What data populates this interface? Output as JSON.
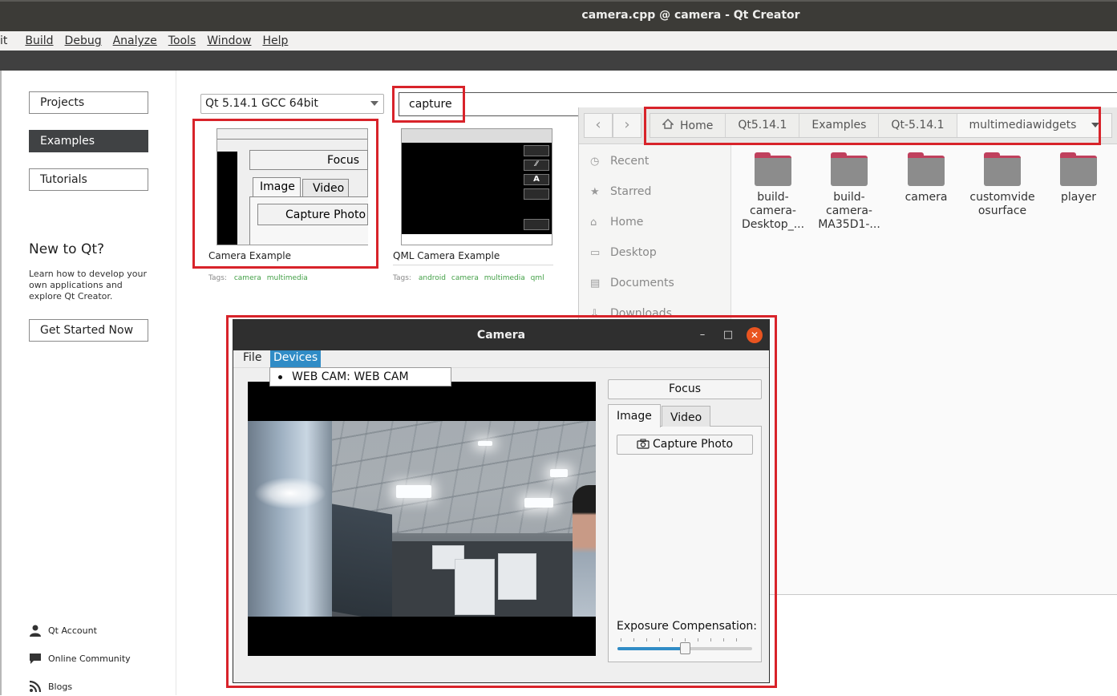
{
  "window": {
    "title": "camera.cpp @ camera - Qt Creator"
  },
  "menubar": {
    "items": [
      "it",
      "Build",
      "Debug",
      "Analyze",
      "Tools",
      "Window",
      "Help"
    ]
  },
  "welcome": {
    "nav": [
      "Projects",
      "Examples",
      "Tutorials"
    ],
    "active_nav": "Examples",
    "new_title": "New to Qt?",
    "new_desc": "Learn how to develop your own applications and explore Qt Creator.",
    "get_started": "Get Started Now",
    "footer": [
      {
        "label": "Qt Account",
        "icon": "user-icon"
      },
      {
        "label": "Online Community",
        "icon": "chat-icon"
      },
      {
        "label": "Blogs",
        "icon": "rss-icon"
      }
    ]
  },
  "examples": {
    "qt_version": "Qt 5.14.1 GCC 64bit",
    "search_value": "capture",
    "tags_label": "Tags:",
    "items": [
      {
        "name": "Camera Example",
        "tags": [
          "camera",
          "multimedia"
        ],
        "thumb": {
          "focus": "Focus",
          "tab_image": "Image",
          "tab_video": "Video",
          "capture": "Capture Photo"
        }
      },
      {
        "name": "QML Camera Example",
        "tags": [
          "android",
          "camera",
          "multimedia",
          "qml"
        ]
      }
    ]
  },
  "files": {
    "breadcrumb": [
      "Home",
      "Qt5.14.1",
      "Examples",
      "Qt-5.14.1",
      "multimediawidgets"
    ],
    "sidebar": [
      {
        "label": "Recent",
        "icon": "clock-icon"
      },
      {
        "label": "Starred",
        "icon": "star-icon"
      },
      {
        "label": "Home",
        "icon": "home-icon"
      },
      {
        "label": "Desktop",
        "icon": "desktop-icon"
      },
      {
        "label": "Documents",
        "icon": "document-icon"
      },
      {
        "label": "Downloads",
        "icon": "download-icon"
      }
    ],
    "folders": [
      {
        "line1": "build-",
        "line2": "camera-",
        "line3": "Desktop_..."
      },
      {
        "line1": "build-",
        "line2": "camera-",
        "line3": "MA35D1-..."
      },
      {
        "line1": "camera",
        "line2": "",
        "line3": ""
      },
      {
        "line1": "customvide",
        "line2": "osurface",
        "line3": ""
      },
      {
        "line1": "player",
        "line2": "",
        "line3": ""
      }
    ]
  },
  "camera": {
    "title": "Camera",
    "menu": [
      "File",
      "Devices"
    ],
    "active_menu": "Devices",
    "device_item": "WEB CAM: WEB CAM",
    "focus": "Focus",
    "tabs": [
      "Image",
      "Video"
    ],
    "active_tab": "Image",
    "capture": "Capture Photo",
    "exposure_label": "Exposure Compensation:",
    "exposure_level": 0.5
  },
  "colors": {
    "highlight": "#d8232a",
    "selection": "#308cc6",
    "active_nav": "#404244",
    "tag": "#43a047"
  }
}
